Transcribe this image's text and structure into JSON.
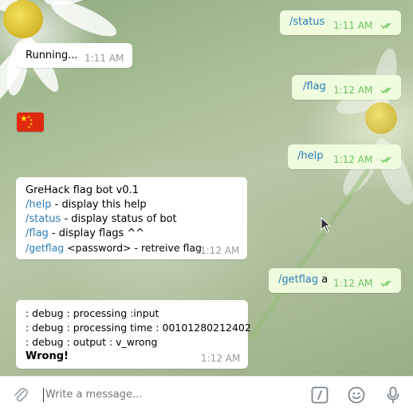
{
  "messages": [
    {
      "text": "/status",
      "time": "1:11 AM"
    },
    {
      "text": "Running...",
      "time": "1:11 AM"
    },
    {
      "emoji": "flag-cn-icon"
    },
    {
      "text": "/flag",
      "time": "1:12 AM"
    },
    {
      "text": "/help",
      "time": "1:12 AM"
    },
    {
      "title": "GreHack flag bot v0.1",
      "lines": [
        {
          "cmd": "/help",
          "desc": " - display this help"
        },
        {
          "cmd": "/status",
          "desc": " - display status of bot"
        },
        {
          "cmd": "/flag",
          "desc": " - display flags ^^"
        },
        {
          "cmd": "/getflag",
          "desc": " <password> - retreive flag"
        }
      ],
      "time": "1:12 AM"
    },
    {
      "cmd": "/getflag",
      "arg": " a",
      "time": "1:12 AM"
    },
    {
      "lines": [
        ": debug : processing :input",
        ": debug : processing time : 00101280212402",
        ": debug : output : v_wrong"
      ],
      "result": "Wrong!",
      "time": "1:12 AM"
    }
  ],
  "composer": {
    "placeholder": "Write a message...",
    "icons": [
      "attach-icon",
      "commands-icon",
      "emoji-icon",
      "microphone-icon"
    ]
  },
  "colors": {
    "outgoing_bubble": "#effdde",
    "incoming_bubble": "#ffffff",
    "command_link": "#2a7bb5",
    "read_check": "#6cbf5e"
  }
}
